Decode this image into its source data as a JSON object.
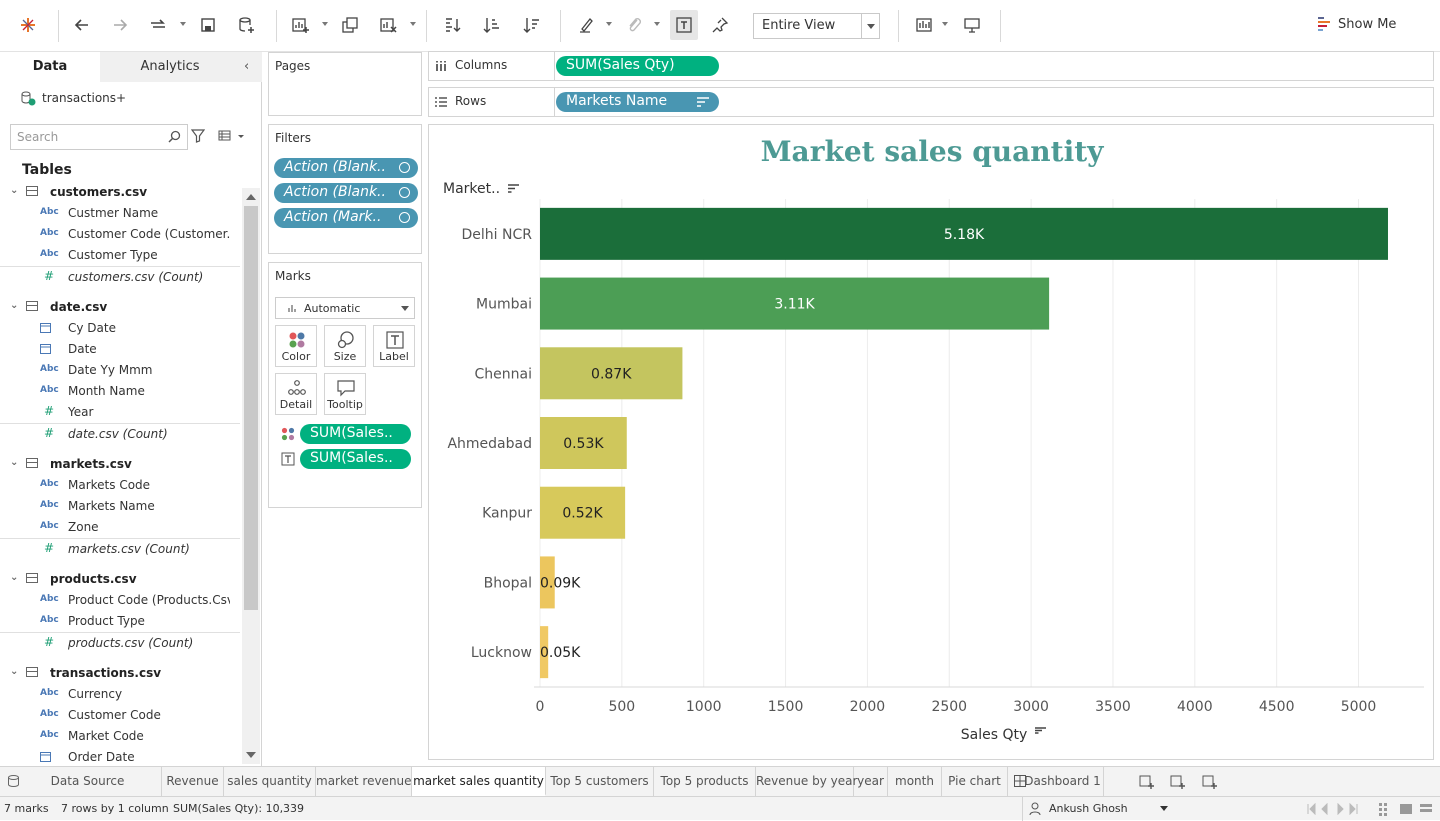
{
  "toolbar": {
    "fit": "Entire View",
    "show_me": "Show Me"
  },
  "data_pane": {
    "tab_data": "Data",
    "tab_analytics": "Analytics",
    "datasource": "transactions+",
    "search_placeholder": "Search",
    "tables_heading": "Tables",
    "tables": [
      {
        "name": "customers.csv",
        "fields": [
          {
            "type": "Abc",
            "name": "Custmer Name"
          },
          {
            "type": "Abc",
            "name": "Customer Code (Customer..."
          },
          {
            "type": "Abc",
            "name": "Customer Type"
          },
          {
            "type": "#",
            "name": "customers.csv (Count)",
            "measure": true
          }
        ]
      },
      {
        "name": "date.csv",
        "fields": [
          {
            "type": "date",
            "name": "Cy Date"
          },
          {
            "type": "date",
            "name": "Date"
          },
          {
            "type": "Abc",
            "name": "Date Yy Mmm"
          },
          {
            "type": "Abc",
            "name": "Month Name"
          },
          {
            "type": "#",
            "name": "Year"
          },
          {
            "type": "#",
            "name": "date.csv (Count)",
            "measure": true
          }
        ]
      },
      {
        "name": "markets.csv",
        "fields": [
          {
            "type": "Abc",
            "name": "Markets Code"
          },
          {
            "type": "Abc",
            "name": "Markets Name"
          },
          {
            "type": "Abc",
            "name": "Zone"
          },
          {
            "type": "#",
            "name": "markets.csv (Count)",
            "measure": true
          }
        ]
      },
      {
        "name": "products.csv",
        "fields": [
          {
            "type": "Abc",
            "name": "Product Code (Products.Csv)"
          },
          {
            "type": "Abc",
            "name": "Product Type"
          },
          {
            "type": "#",
            "name": "products.csv (Count)",
            "measure": true
          }
        ]
      },
      {
        "name": "transactions.csv",
        "fields": [
          {
            "type": "Abc",
            "name": "Currency"
          },
          {
            "type": "Abc",
            "name": "Customer Code"
          },
          {
            "type": "Abc",
            "name": "Market Code"
          },
          {
            "type": "date",
            "name": "Order Date"
          }
        ]
      }
    ]
  },
  "pages": {
    "title": "Pages"
  },
  "filters": {
    "title": "Filters",
    "pills": [
      "Action (Blank..",
      "Action (Blank..",
      "Action (Mark.."
    ]
  },
  "marks": {
    "title": "Marks",
    "type": "Automatic",
    "buttons": [
      "Color",
      "Size",
      "Label",
      "Detail",
      "Tooltip"
    ],
    "pills": [
      "SUM(Sales..",
      "SUM(Sales.."
    ]
  },
  "shelves": {
    "columns_label": "Columns",
    "columns_pill": "SUM(Sales Qty)",
    "rows_label": "Rows",
    "rows_pill": "Markets Name"
  },
  "chart_data": {
    "type": "bar",
    "orientation": "horizontal",
    "title": "Market sales quantity",
    "row_header": "Market..",
    "xlabel": "Sales Qty",
    "xlim": [
      0,
      5400
    ],
    "xticks": [
      0,
      500,
      1000,
      1500,
      2000,
      2500,
      3000,
      3500,
      4000,
      4500,
      5000
    ],
    "grid": "vertical",
    "categories": [
      "Delhi NCR",
      "Mumbai",
      "Chennai",
      "Ahmedabad",
      "Kanpur",
      "Bhopal",
      "Lucknow"
    ],
    "values": [
      5180,
      3110,
      870,
      530,
      520,
      90,
      50
    ],
    "labels": [
      "5.18K",
      "3.11K",
      "0.87K",
      "0.53K",
      "0.52K",
      "0.09K",
      "0.05K"
    ],
    "colors": [
      "#1b6e3a",
      "#4c9e55",
      "#c4c55f",
      "#cfc75c",
      "#d7c95b",
      "#ecc65e",
      "#f0c964"
    ],
    "label_colors": [
      "#ffffff",
      "#ffffff",
      "#222222",
      "#222222",
      "#222222",
      "#222222",
      "#222222"
    ]
  },
  "sheet_tabs": [
    "Data Source",
    "Revenue",
    "sales quantity",
    "market revenue",
    "market sales quantity",
    "Top 5 customers",
    "Top 5 products",
    "Revenue by year",
    "year",
    "month",
    "Pie chart",
    "Dashboard 1"
  ],
  "active_tab": "market sales quantity",
  "status": {
    "marks": "7 marks",
    "rows": "7 rows by 1 column",
    "sum": "SUM(Sales Qty): 10,339",
    "user": "Ankush Ghosh"
  }
}
